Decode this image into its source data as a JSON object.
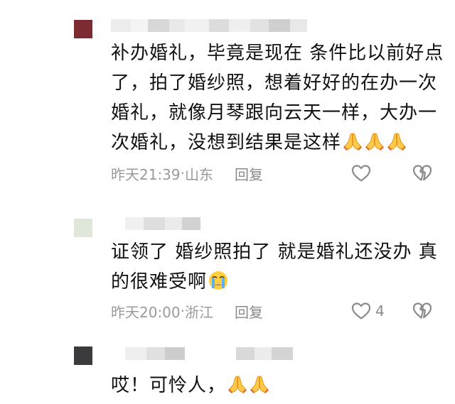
{
  "comments": [
    {
      "avatar_color": "#7b2b31",
      "text_lines": [
        "补办婚礼，毕竟是现在 条件比以前好点",
        "了，拍了婚纱照，想着好好的在办一次",
        "婚礼，就像月琴跟向云天一样，大办一",
        "次婚礼，没想到结果是这样"
      ],
      "emoji": [
        "folded-hands",
        "folded-hands",
        "folded-hands"
      ],
      "time": "昨天21:39",
      "location": "山东",
      "reply_label": "回复",
      "likes": ""
    },
    {
      "avatar_color": "#dfe7da",
      "text_lines": [
        "证领了 婚纱照拍了 就是婚礼还没办 真",
        "的很难受啊"
      ],
      "emoji": [
        "crying-face"
      ],
      "time": "昨天20:00",
      "location": "浙江",
      "reply_label": "回复",
      "likes": "4"
    },
    {
      "avatar_color": "#3b3b3d",
      "text_lines": [
        "哎！可怜人，"
      ],
      "emoji": [
        "folded-hands",
        "folded-hands"
      ],
      "time": "",
      "location": "",
      "reply_label": "",
      "likes": ""
    }
  ],
  "separator": " · ",
  "icons": {
    "like": "heart-outline-icon",
    "dislike": "broken-heart-icon",
    "emoji_hands": "folded-hands-emoji",
    "emoji_cry": "crying-face-emoji"
  }
}
